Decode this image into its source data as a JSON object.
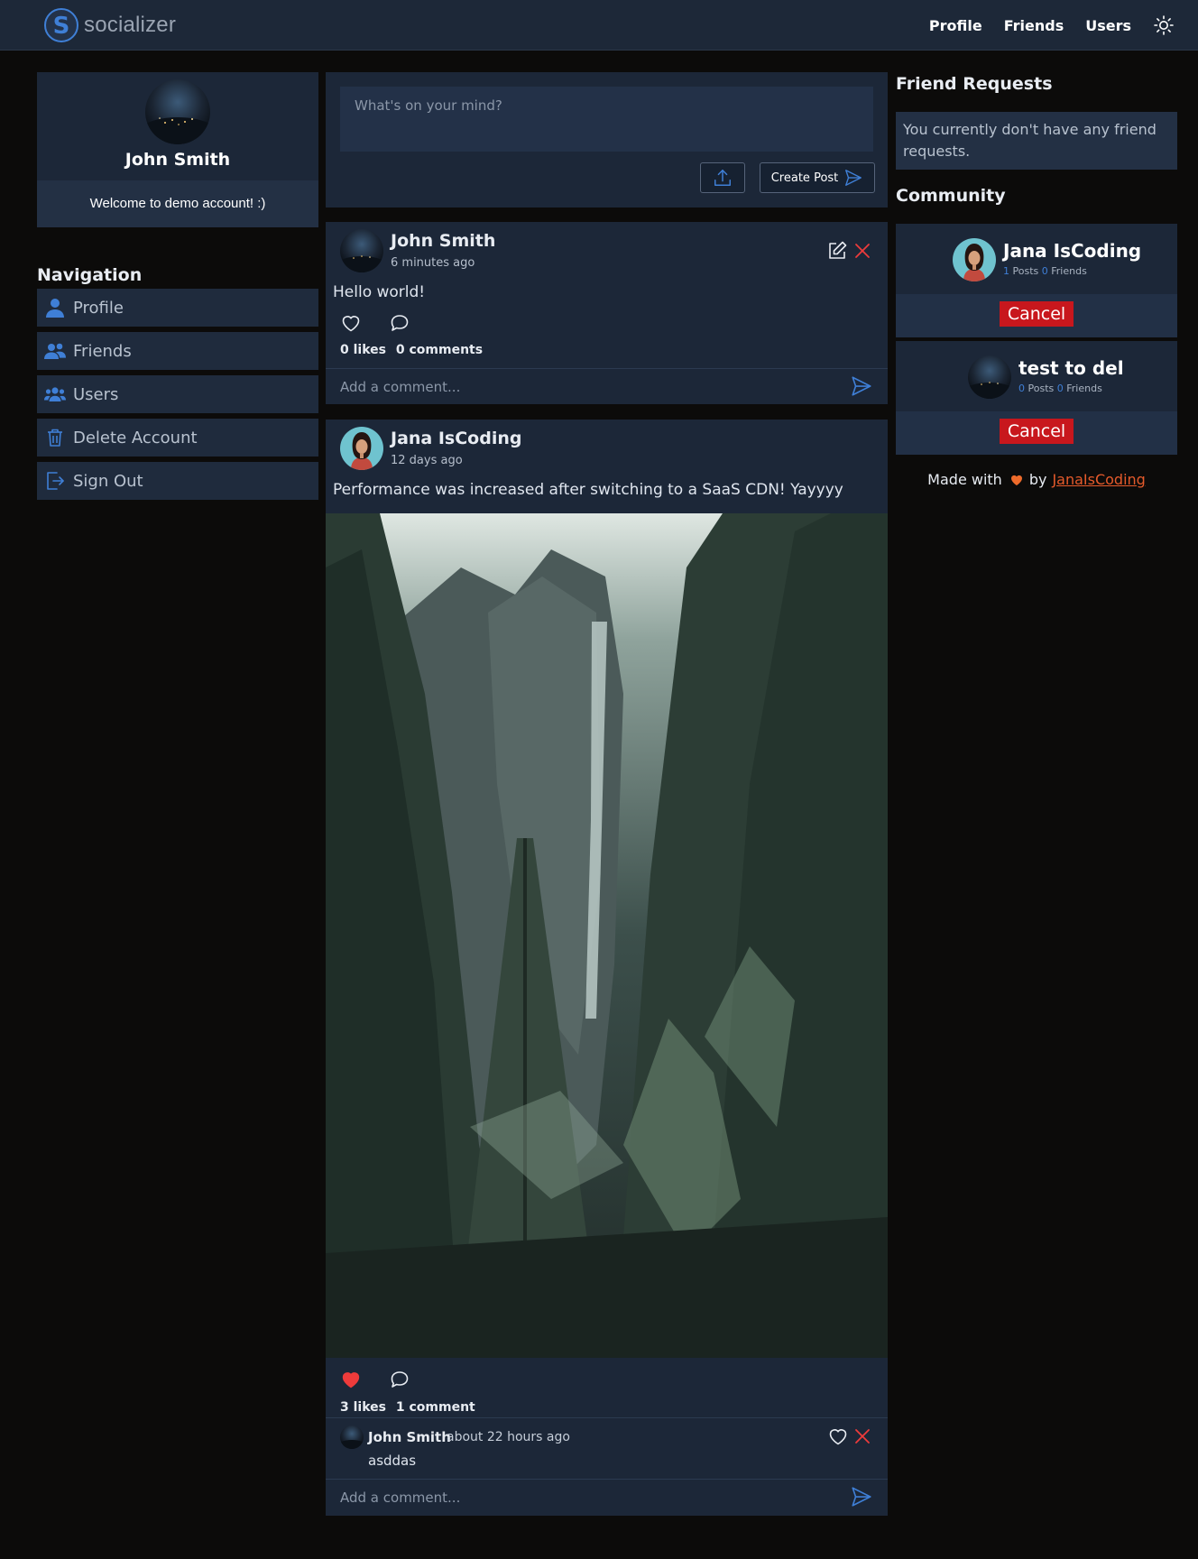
{
  "app": {
    "brand_name": "socializer",
    "logo_letter": "S"
  },
  "topnav": {
    "items": [
      "Profile",
      "Friends",
      "Users"
    ],
    "theme_icon": "sun-icon"
  },
  "profile": {
    "name": "John Smith",
    "welcome": "Welcome to demo account! :)"
  },
  "navigation": {
    "title": "Navigation",
    "items": [
      {
        "label": "Profile",
        "icon": "user-icon"
      },
      {
        "label": "Friends",
        "icon": "friends-icon"
      },
      {
        "label": "Users",
        "icon": "users-icon"
      },
      {
        "label": "Delete Account",
        "icon": "trash-icon"
      },
      {
        "label": "Sign Out",
        "icon": "sign-out-icon"
      }
    ]
  },
  "composer": {
    "placeholder": "What's on your mind?",
    "create_label": "Create Post"
  },
  "posts": [
    {
      "author": "John Smith",
      "time": "6 minutes ago",
      "text": "Hello world!",
      "likes": "0 likes",
      "comments": "0 comments",
      "liked": false,
      "comment_placeholder": "Add a comment..."
    },
    {
      "author": "Jana IsCoding",
      "time": "12 days ago",
      "text": "Performance was increased after switching to a SaaS CDN! Yayyyy",
      "likes": "3 likes",
      "comments": "1 comment",
      "liked": true,
      "comment_placeholder": "Add a comment...",
      "comment_list": [
        {
          "author": "John Smith",
          "time": "about 22 hours ago",
          "text": "asddas"
        }
      ]
    }
  ],
  "friend_requests": {
    "title": "Friend Requests",
    "empty_text": "You currently don't have any friend requests."
  },
  "community": {
    "title": "Community",
    "users": [
      {
        "name": "Jana IsCoding",
        "posts": "1",
        "posts_label": "Posts",
        "friends": "0",
        "friends_label": "Friends",
        "action": "Cancel"
      },
      {
        "name": "test to del",
        "posts": "0",
        "posts_label": "Posts",
        "friends": "0",
        "friends_label": "Friends",
        "action": "Cancel"
      }
    ]
  },
  "footer": {
    "made_with": "Made with",
    "by": "by",
    "author": "JanaIsCoding"
  },
  "colors": {
    "accent_blue": "#3f7fd6",
    "danger_red": "#c8171d",
    "heart_red": "#ee3b3b",
    "link_orange": "#e55a2b"
  }
}
